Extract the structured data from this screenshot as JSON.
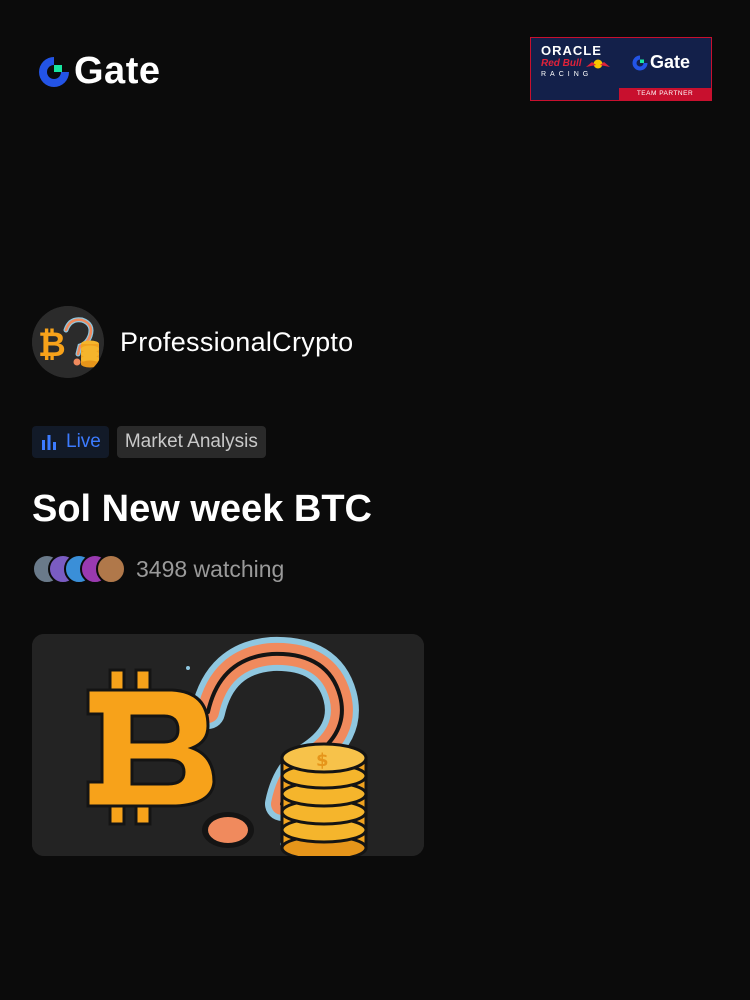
{
  "brand": {
    "name": "Gate",
    "accent_blue": "#2354e6",
    "accent_green": "#17e6a1"
  },
  "partner_badge": {
    "line1": "ORACLE",
    "line2": "Red Bull",
    "line3": "RACING",
    "gate_label": "Gate",
    "bottom_label": "TEAM PARTNER"
  },
  "channel": {
    "username": "ProfessionalCrypto",
    "avatar_icon": "bitcoin-question-icon"
  },
  "tags": {
    "live_label": "Live",
    "category_label": "Market Analysis",
    "live_color": "#3c7bff"
  },
  "stream": {
    "title": "Sol New week BTC",
    "watching_text": "3498 watching",
    "thumbnail_icon": "bitcoin-question-coins-icon"
  }
}
